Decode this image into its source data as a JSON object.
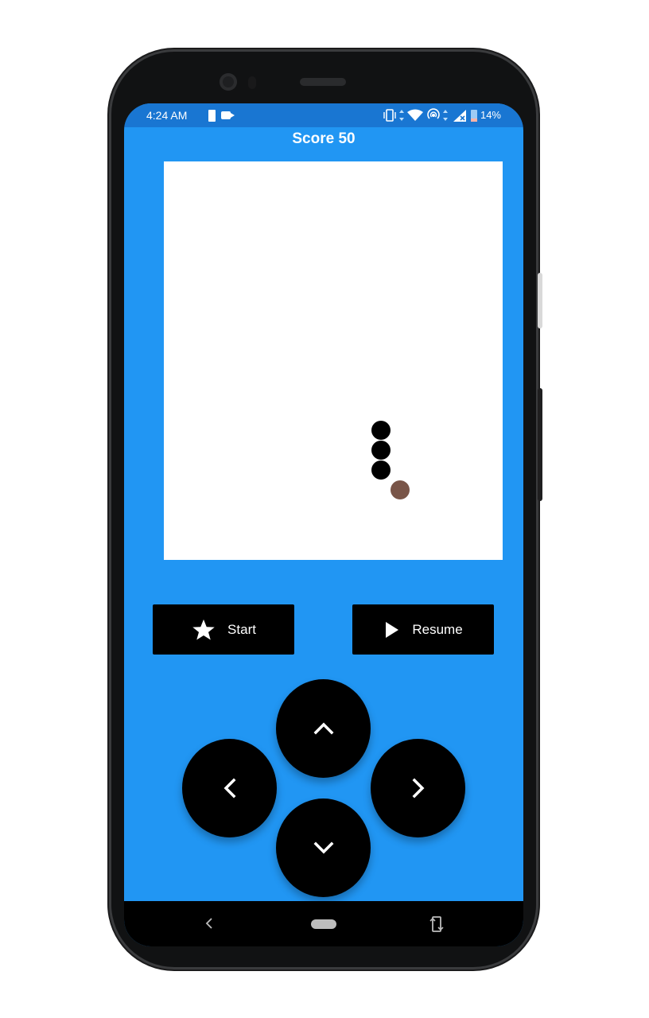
{
  "status_bar": {
    "time": "4:24 AM",
    "battery_percent": "14%",
    "icons": [
      "battery-alert-icon",
      "video-record-icon",
      "vibrate-icon",
      "wifi-icon",
      "hotspot-icon",
      "no-signal-icon",
      "battery-icon"
    ]
  },
  "game": {
    "score_label": "Score 50",
    "snake_color": "#000000",
    "food_color": "#795548",
    "board_color": "#ffffff",
    "background_color": "#2196f3"
  },
  "buttons": {
    "start_label": "Start",
    "start_icon": "star-icon",
    "resume_label": "Resume",
    "resume_icon": "play-icon"
  },
  "dpad": {
    "up_icon": "chevron-up-icon",
    "down_icon": "chevron-down-icon",
    "left_icon": "chevron-left-icon",
    "right_icon": "chevron-right-icon"
  },
  "nav_bar": {
    "back_icon": "nav-back-icon",
    "home_icon": "nav-home-pill",
    "rotate_icon": "rotate-screen-icon"
  }
}
